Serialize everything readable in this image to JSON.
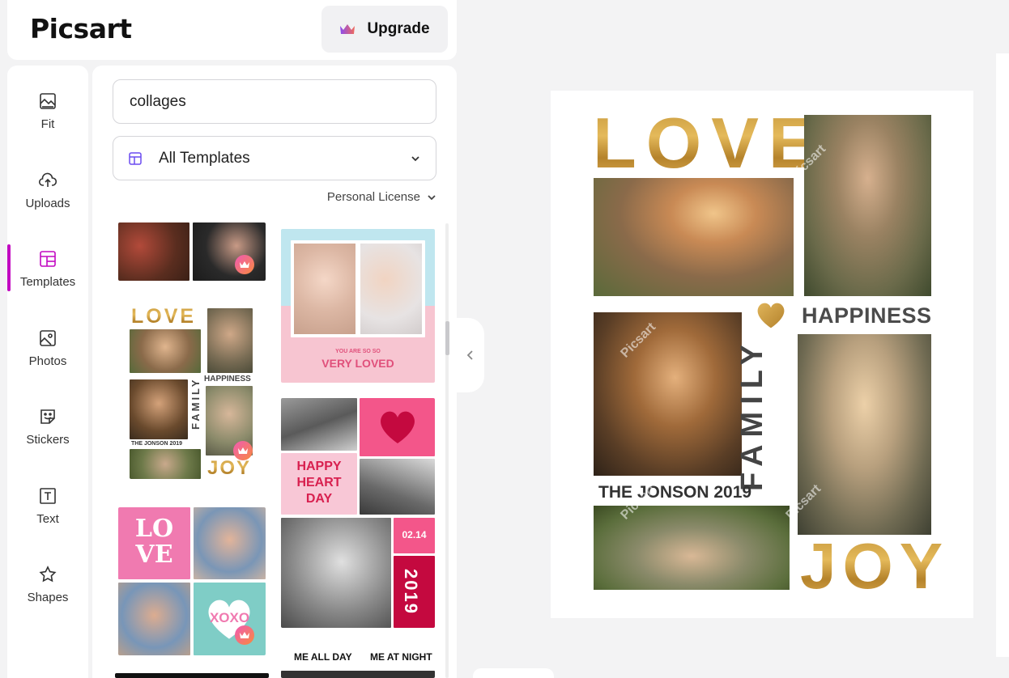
{
  "brand": {
    "logo_text": "Picsart",
    "upgrade_label": "Upgrade"
  },
  "rail": {
    "items": [
      {
        "label": "Fit",
        "icon": "image-fit-icon"
      },
      {
        "label": "Uploads",
        "icon": "cloud-upload-icon"
      },
      {
        "label": "Templates",
        "icon": "templates-icon"
      },
      {
        "label": "Photos",
        "icon": "photos-icon"
      },
      {
        "label": "Stickers",
        "icon": "sticker-icon"
      },
      {
        "label": "Text",
        "icon": "text-icon"
      },
      {
        "label": "Shapes",
        "icon": "star-icon"
      }
    ],
    "active": "Templates"
  },
  "panel": {
    "search_value": "collages",
    "select_value": "All Templates",
    "license_label": "Personal License"
  },
  "thumbs": {
    "baby": {
      "line1": "YOU ARE SO SO",
      "line2": "VERY LOVED"
    },
    "family": {
      "love": "LOVE",
      "happiness": "HAPPINESS",
      "family": "FAMILY",
      "jonson": "THE JONSON 2019",
      "joy": "JOY"
    },
    "valentine": {
      "happy": "HAPPY",
      "heart": "HEART",
      "day": "DAY",
      "date": "02.14",
      "year": "2019"
    },
    "lovexoxo": {
      "lo": "LO",
      "ve": "VE",
      "xoxo": "XOXO"
    },
    "meallday": {
      "left": "ME ALL DAY",
      "right": "ME AT NIGHT"
    }
  },
  "canvas": {
    "love": "LOVE",
    "happiness": "HAPPINESS",
    "family": "FAMILY",
    "jonson": "THE JONSON 2019",
    "joy": "JOY",
    "watermark": "Picsart"
  },
  "colors": {
    "accent": "#c209c1",
    "gold": "#c89a3e",
    "pink": "#f5a3c0"
  }
}
